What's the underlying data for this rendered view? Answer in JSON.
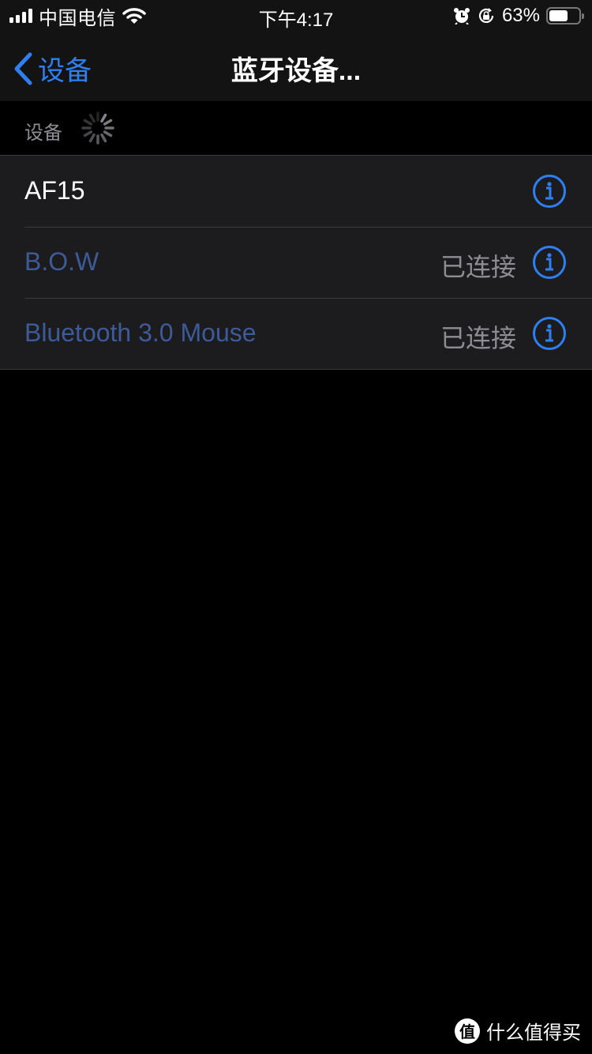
{
  "status_bar": {
    "carrier": "中国电信",
    "time": "下午4:17",
    "battery_percent": "63%",
    "battery_level": 0.63,
    "signal_bars": 4,
    "icons": [
      "signal-icon",
      "wifi-icon",
      "alarm-icon",
      "rotation-lock-icon",
      "battery-icon"
    ]
  },
  "nav": {
    "back_label": "设备",
    "title": "蓝牙设备..."
  },
  "section": {
    "label": "设备",
    "loading": true
  },
  "devices": [
    {
      "name": "AF15",
      "status": "",
      "name_color": "#ffffff"
    },
    {
      "name": "B.O.W",
      "status": "已连接",
      "name_color": "#3d5a99"
    },
    {
      "name": "Bluetooth 3.0 Mouse",
      "status": "已连接",
      "name_color": "#3d5a99"
    }
  ],
  "colors": {
    "accent": "#2f7ff0",
    "dim_device": "#3d5a99",
    "status_text": "#8d8d93",
    "cell_bg": "#1c1c1e"
  },
  "watermark": {
    "logo_char": "值",
    "text": "什么值得买"
  }
}
